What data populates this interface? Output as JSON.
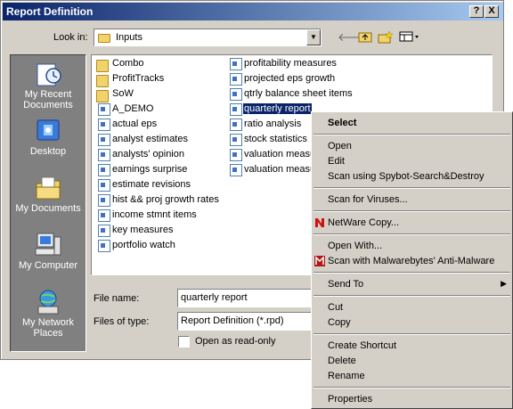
{
  "window": {
    "title": "Report Definition",
    "help_btn": "?",
    "close_btn": "X"
  },
  "toolbar": {
    "lookin_label": "Look in:",
    "lookin_value": "Inputs"
  },
  "places": [
    {
      "label": "My Recent Documents",
      "icon": "recent-docs-icon"
    },
    {
      "label": "Desktop",
      "icon": "desktop-icon"
    },
    {
      "label": "My Documents",
      "icon": "my-documents-icon"
    },
    {
      "label": "My Computer",
      "icon": "my-computer-icon"
    },
    {
      "label": "My Network Places",
      "icon": "network-places-icon"
    }
  ],
  "files_col1": [
    {
      "name": "Combo",
      "type": "folder"
    },
    {
      "name": "ProfitTracks",
      "type": "folder"
    },
    {
      "name": "SoW",
      "type": "folder"
    },
    {
      "name": "A_DEMO",
      "type": "file"
    },
    {
      "name": "actual eps",
      "type": "file"
    },
    {
      "name": "analyst estimates",
      "type": "file"
    },
    {
      "name": "analysts' opinion",
      "type": "file"
    },
    {
      "name": "earnings surprise",
      "type": "file"
    },
    {
      "name": "estimate revisions",
      "type": "file"
    },
    {
      "name": "hist && proj growth rates",
      "type": "file"
    },
    {
      "name": "income stmnt items",
      "type": "file"
    },
    {
      "name": "key measures",
      "type": "file"
    },
    {
      "name": "portfolio watch",
      "type": "file"
    }
  ],
  "files_col2": [
    {
      "name": "profitability measures",
      "type": "file"
    },
    {
      "name": "projected eps growth",
      "type": "file"
    },
    {
      "name": "qtrly balance sheet items",
      "type": "file"
    },
    {
      "name": "quarterly report",
      "type": "file",
      "selected": true
    },
    {
      "name": "ratio analysis",
      "type": "file"
    },
    {
      "name": "stock statistics",
      "type": "file"
    },
    {
      "name": "valuation measu",
      "type": "file"
    },
    {
      "name": "valuation measu",
      "type": "file"
    }
  ],
  "form": {
    "filename_label": "File name:",
    "filename_value": "quarterly report",
    "filetype_label": "Files of type:",
    "filetype_value": "Report Definition (*.rpd)",
    "readonly_label": "Open as read-only"
  },
  "context_menu": {
    "items": [
      {
        "label": "Select",
        "bold": true
      },
      {
        "label": "Open"
      },
      {
        "label": "Edit"
      },
      {
        "label": "Scan using Spybot-Search&Destroy"
      },
      {
        "label": "Scan for Viruses..."
      },
      {
        "label": "NetWare Copy..."
      },
      {
        "label": "Open With..."
      },
      {
        "label": "Scan with Malwarebytes' Anti-Malware"
      },
      {
        "label": "Send To",
        "submenu": true
      },
      {
        "label": "Cut"
      },
      {
        "label": "Copy"
      },
      {
        "label": "Create Shortcut"
      },
      {
        "label": "Delete"
      },
      {
        "label": "Rename"
      },
      {
        "label": "Properties"
      }
    ]
  }
}
